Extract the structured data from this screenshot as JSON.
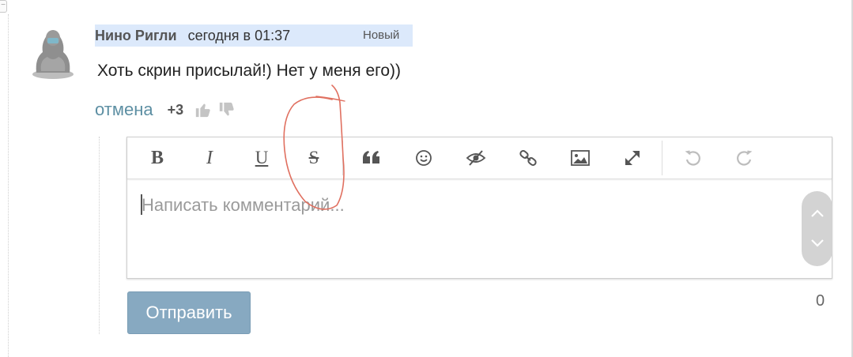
{
  "comment": {
    "author": "Нино Ригли",
    "timestamp": "сегодня в 01:37",
    "badge": "Новый",
    "text": "Хоть скрин присылай!) Нет у меня его))"
  },
  "actions": {
    "cancel_label": "отмена",
    "score": "+3"
  },
  "editor": {
    "toolbar": [
      {
        "name": "bold",
        "glyph": "B"
      },
      {
        "name": "italic",
        "glyph": "I"
      },
      {
        "name": "underline",
        "glyph": "U"
      },
      {
        "name": "strikethrough",
        "glyph": "S"
      },
      {
        "name": "quote",
        "glyph": "❝"
      },
      {
        "name": "emoji",
        "icon": "smile-icon"
      },
      {
        "name": "spoiler",
        "icon": "eye-slash-icon"
      },
      {
        "name": "link",
        "icon": "link-icon"
      },
      {
        "name": "image",
        "icon": "image-icon"
      },
      {
        "name": "fullscreen",
        "icon": "expand-icon"
      },
      {
        "name": "undo",
        "icon": "undo-icon"
      },
      {
        "name": "redo",
        "icon": "redo-icon"
      }
    ],
    "placeholder": "Написать комментарий..."
  },
  "submit_label": "Отправить",
  "char_count": "0",
  "colors": {
    "header_highlight": "#dce9fb",
    "link": "#5d8fa3",
    "submit_bg": "#87a9c1",
    "annotation": "#e07060"
  }
}
